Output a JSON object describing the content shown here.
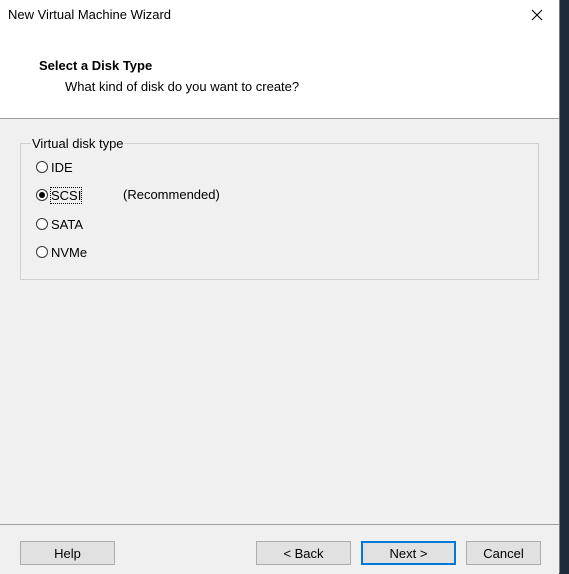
{
  "window": {
    "title": "New Virtual Machine Wizard"
  },
  "header": {
    "title": "Select a Disk Type",
    "subtitle": "What kind of disk do you want to create?"
  },
  "disk_group": {
    "legend": "Virtual disk type",
    "options": [
      {
        "label": "IDE",
        "checked": false
      },
      {
        "label": "SCSI",
        "checked": true,
        "note": "(Recommended)"
      },
      {
        "label": "SATA",
        "checked": false
      },
      {
        "label": "NVMe",
        "checked": false
      }
    ]
  },
  "footer": {
    "help_label": "Help",
    "back_label": "< Back",
    "next_label": "Next >",
    "cancel_label": "Cancel"
  },
  "icons": {
    "close": "close-icon"
  }
}
